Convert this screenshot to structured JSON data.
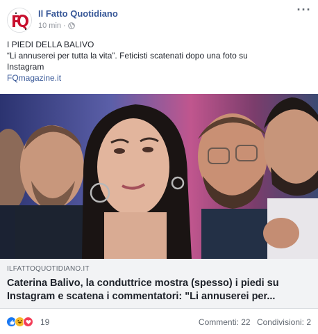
{
  "header": {
    "page_name": "Il Fatto Quotidiano",
    "time": "10 min",
    "separator": "·",
    "more_icon": "more-options-icon"
  },
  "post": {
    "lines": [
      "I PIEDI DELLA BALIVO",
      "“Li annuserei per tutta la vita”. Feticisti scatenati dopo una foto su",
      "Instagram"
    ],
    "link_text": "FQmagazine.it"
  },
  "preview": {
    "domain": "ILFATTOQUOTIDIANO.IT",
    "headline": "Caterina Balivo, la conduttrice mostra (spesso) i piedi su Instagram e scatena i commentatori: \"Li annuserei per..."
  },
  "reactions": {
    "icons": [
      "like-reaction-icon",
      "haha-reaction-icon",
      "love-reaction-icon"
    ],
    "count": "19",
    "comments": "Commenti: 22",
    "shares": "Condivisioni: 2"
  },
  "colors": {
    "link": "#385898",
    "like": "#1877f2",
    "haha": "#f7b928",
    "love": "#f33e58"
  }
}
